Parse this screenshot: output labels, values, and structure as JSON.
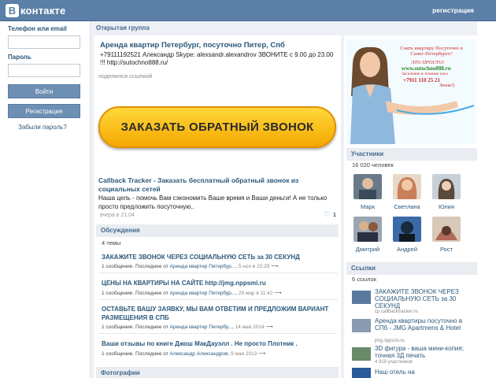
{
  "header": {
    "logo_letter": "В",
    "logo_text": "контакте",
    "register_link": "регистрация"
  },
  "login": {
    "phone_label": "Телефон или email",
    "password_label": "Пароль",
    "login_button": "Войти",
    "register_button": "Регистрация",
    "forgot_link": "Забыли пароль?"
  },
  "group": {
    "type": "Открытая группа"
  },
  "post": {
    "title": "Аренда квартир Петербург, посуточно Питер, Спб",
    "text": "+79111192521 Александр Skype: alexsandr.alexandrov ЗВОНИТЕ с 9.00 до 23.00 !!! http://sutochno888.ru/",
    "shared": "поделился ссылкой",
    "cta_text": "ЗАКАЗАТЬ ОБРАТНЫЙ ЗВОНОК",
    "link_title": "Callback Tracker - Заказать бесплатный обратный звонок из социальных сетей",
    "link_desc": "Наша цель - помочь Вам сэкономить Ваше время и Ваши деньги! А не только просто предложить посуточную..",
    "date": "вчера в 21:04",
    "likes": "1"
  },
  "discussions": {
    "header": "Обсуждения",
    "count": "4 темы",
    "items": [
      {
        "title": "ЗАКАЖИТЕ ЗВОНОК ЧЕРЕЗ СОЦИАЛЬНУЮ СЕТЬ за 30 СЕКУНД",
        "meta_prefix": "1 сообщение. Последнее от",
        "author": "Аренда квартир Петербур...",
        "time": "5 ноя в 23:29"
      },
      {
        "title": "ЦЕНЫ НА КВАРТИРЫ НА САЙТЕ http://jmg.nppsmi.ru",
        "meta_prefix": "1 сообщение. Последнее от",
        "author": "Аренда квартир Петербур...",
        "time": "29 мар в 11:42"
      },
      {
        "title": "ОСТАВЬТЕ ВАШУ ЗАЯВКУ, МЫ ВАМ ОТВЕТИМ И ПРЕДЛОЖИМ ВАРИАНТ РАЗМЕЩЕНИЯ В СПБ",
        "meta_prefix": "1 сообщение. Последнее от",
        "author": "Аренда квартир Петербу...",
        "time": "14 мая 2014"
      },
      {
        "title": "Ваши отзывы по книге Джош МакДауэлл . Не просто Плотник .",
        "meta_prefix": "1 сообщение. Последнее от",
        "author": "Александр Александров",
        "time": "9 мая 2013"
      }
    ]
  },
  "photos": {
    "header": "Фотографии"
  },
  "ad": {
    "headline": "Снять квартиру Посуточно в Санкт-Петербурге?",
    "yes": "ЭТО ПРОСТО!",
    "site": "www.sutochno888.ru",
    "note": "Заселение в течение часа",
    "phone": "+7911 110 25 21",
    "call": "Звони!)"
  },
  "members": {
    "header": "Участники",
    "count": "16 020 человек",
    "people": [
      {
        "name": "Марк",
        "color": "#6a7a8a"
      },
      {
        "name": "Светлана",
        "color": "#c9805a"
      },
      {
        "name": "Юлия",
        "color": "#9aa0a8"
      },
      {
        "name": "Дмитрий",
        "color": "#8a6a4a"
      },
      {
        "name": "Андрей",
        "color": "#7a8fb0"
      },
      {
        "name": "Рост",
        "color": "#b06a5a"
      }
    ]
  },
  "links": {
    "header": "Ссылки",
    "count": "6 ссылок",
    "items": [
      {
        "title": "ЗАКАЖИТЕ ЗВОНОК ЧЕРЕЗ СОЦИАЛЬНУЮ СЕТЬ за 30 СЕКУНД",
        "sub": "cp.callbacktracker.ru"
      },
      {
        "title": "Аренда квартиры посуточно в СПб - JMG Apartmens & Hotel",
        "sub": "jmg.nppsmi.ru"
      },
      {
        "title": "3D фигура - ваша мини-копия; точная 3Д печать",
        "sub": "4 919 участников"
      },
      {
        "title": "Наш отель на",
        "sub": ""
      }
    ]
  }
}
